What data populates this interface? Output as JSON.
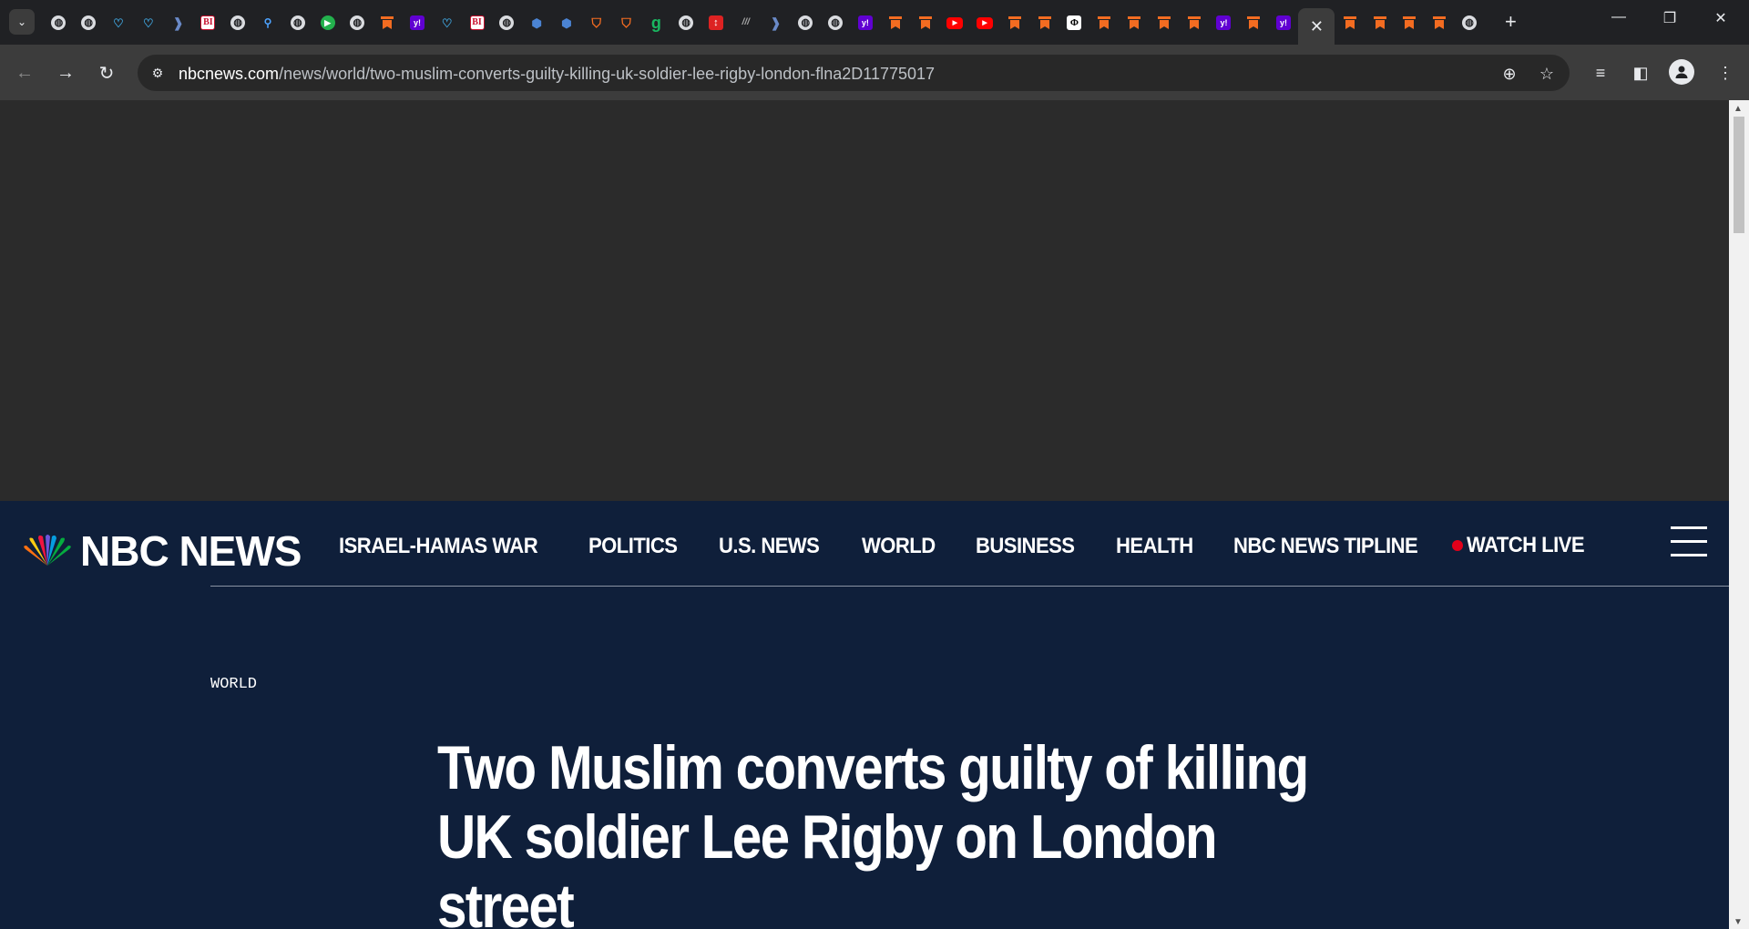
{
  "browser": {
    "tabs": [
      {
        "icon": "globe-icon",
        "glyph": "◍"
      },
      {
        "icon": "globe-icon",
        "glyph": "◍"
      },
      {
        "icon": "heart-icon",
        "glyph": "♡"
      },
      {
        "icon": "heart-icon",
        "glyph": "♡"
      },
      {
        "icon": "bookmark-dark-icon",
        "glyph": "❱"
      },
      {
        "icon": "business-insider-icon",
        "glyph": "BI"
      },
      {
        "icon": "globe-icon",
        "glyph": "◍"
      },
      {
        "icon": "search-icon",
        "glyph": "⚲"
      },
      {
        "icon": "globe-icon",
        "glyph": "◍"
      },
      {
        "icon": "play-icon",
        "glyph": "▶"
      },
      {
        "icon": "globe-icon",
        "glyph": "◍"
      },
      {
        "icon": "bookmark-icon",
        "glyph": ""
      },
      {
        "icon": "yahoo-icon",
        "glyph": "y!"
      },
      {
        "icon": "heart-icon",
        "glyph": "♡"
      },
      {
        "icon": "business-insider-icon",
        "glyph": "BI"
      },
      {
        "icon": "globe-icon",
        "glyph": "◍"
      },
      {
        "icon": "cube-icon",
        "glyph": "⬢"
      },
      {
        "icon": "cube-icon",
        "glyph": "⬢"
      },
      {
        "icon": "shield-icon",
        "glyph": "⛉"
      },
      {
        "icon": "shield-icon",
        "glyph": "⛉"
      },
      {
        "icon": "grammarly-icon",
        "glyph": "g"
      },
      {
        "icon": "globe-icon",
        "glyph": "◍"
      },
      {
        "icon": "red-app-icon",
        "glyph": "↕"
      },
      {
        "icon": "lines-icon",
        "glyph": "///"
      },
      {
        "icon": "bookmark-dark-icon",
        "glyph": "❱"
      },
      {
        "icon": "globe-icon",
        "glyph": "◍"
      },
      {
        "icon": "globe-icon",
        "glyph": "◍"
      },
      {
        "icon": "yahoo-icon",
        "glyph": "y!"
      },
      {
        "icon": "bookmark-icon",
        "glyph": ""
      },
      {
        "icon": "bookmark-icon",
        "glyph": ""
      },
      {
        "icon": "youtube-icon",
        "glyph": "▶"
      },
      {
        "icon": "youtube-icon",
        "glyph": "▶"
      },
      {
        "icon": "bookmark-icon",
        "glyph": ""
      },
      {
        "icon": "bookmark-icon",
        "glyph": ""
      },
      {
        "icon": "news-icon",
        "glyph": "Φ"
      },
      {
        "icon": "bookmark-icon",
        "glyph": ""
      },
      {
        "icon": "bookmark-icon",
        "glyph": ""
      },
      {
        "icon": "bookmark-icon",
        "glyph": ""
      },
      {
        "icon": "bookmark-icon",
        "glyph": ""
      },
      {
        "icon": "yahoo-icon",
        "glyph": "y!"
      },
      {
        "icon": "bookmark-icon",
        "glyph": ""
      },
      {
        "icon": "yahoo-icon",
        "glyph": "y!"
      },
      {
        "icon": "close-icon",
        "glyph": "✕",
        "active": true
      },
      {
        "icon": "bookmark-icon",
        "glyph": ""
      },
      {
        "icon": "bookmark-icon",
        "glyph": ""
      },
      {
        "icon": "bookmark-icon",
        "glyph": ""
      },
      {
        "icon": "bookmark-icon",
        "glyph": ""
      },
      {
        "icon": "globe-icon",
        "glyph": "◍"
      }
    ],
    "new_tab_glyph": "+",
    "url_host": "nbcnews.com",
    "url_path": "/news/world/two-muslim-converts-guilty-killing-uk-soldier-lee-rigby-london-flna2D11775017"
  },
  "page": {
    "logo_text": "NBC NEWS",
    "nav": [
      "ISRAEL-HAMAS WAR",
      "POLITICS",
      "U.S. NEWS",
      "WORLD",
      "BUSINESS",
      "HEALTH",
      "NBC NEWS TIPLINE"
    ],
    "watch_live": "WATCH LIVE",
    "section": "WORLD",
    "headline": "Two Muslim converts guilty of killing UK soldier Lee Rigby on London street"
  },
  "colors": {
    "header_bg": "#0f1f3a",
    "ad_bg": "#2b2b2b",
    "live_dot": "#e1001a",
    "bookmark_orange": "#f36c21"
  }
}
